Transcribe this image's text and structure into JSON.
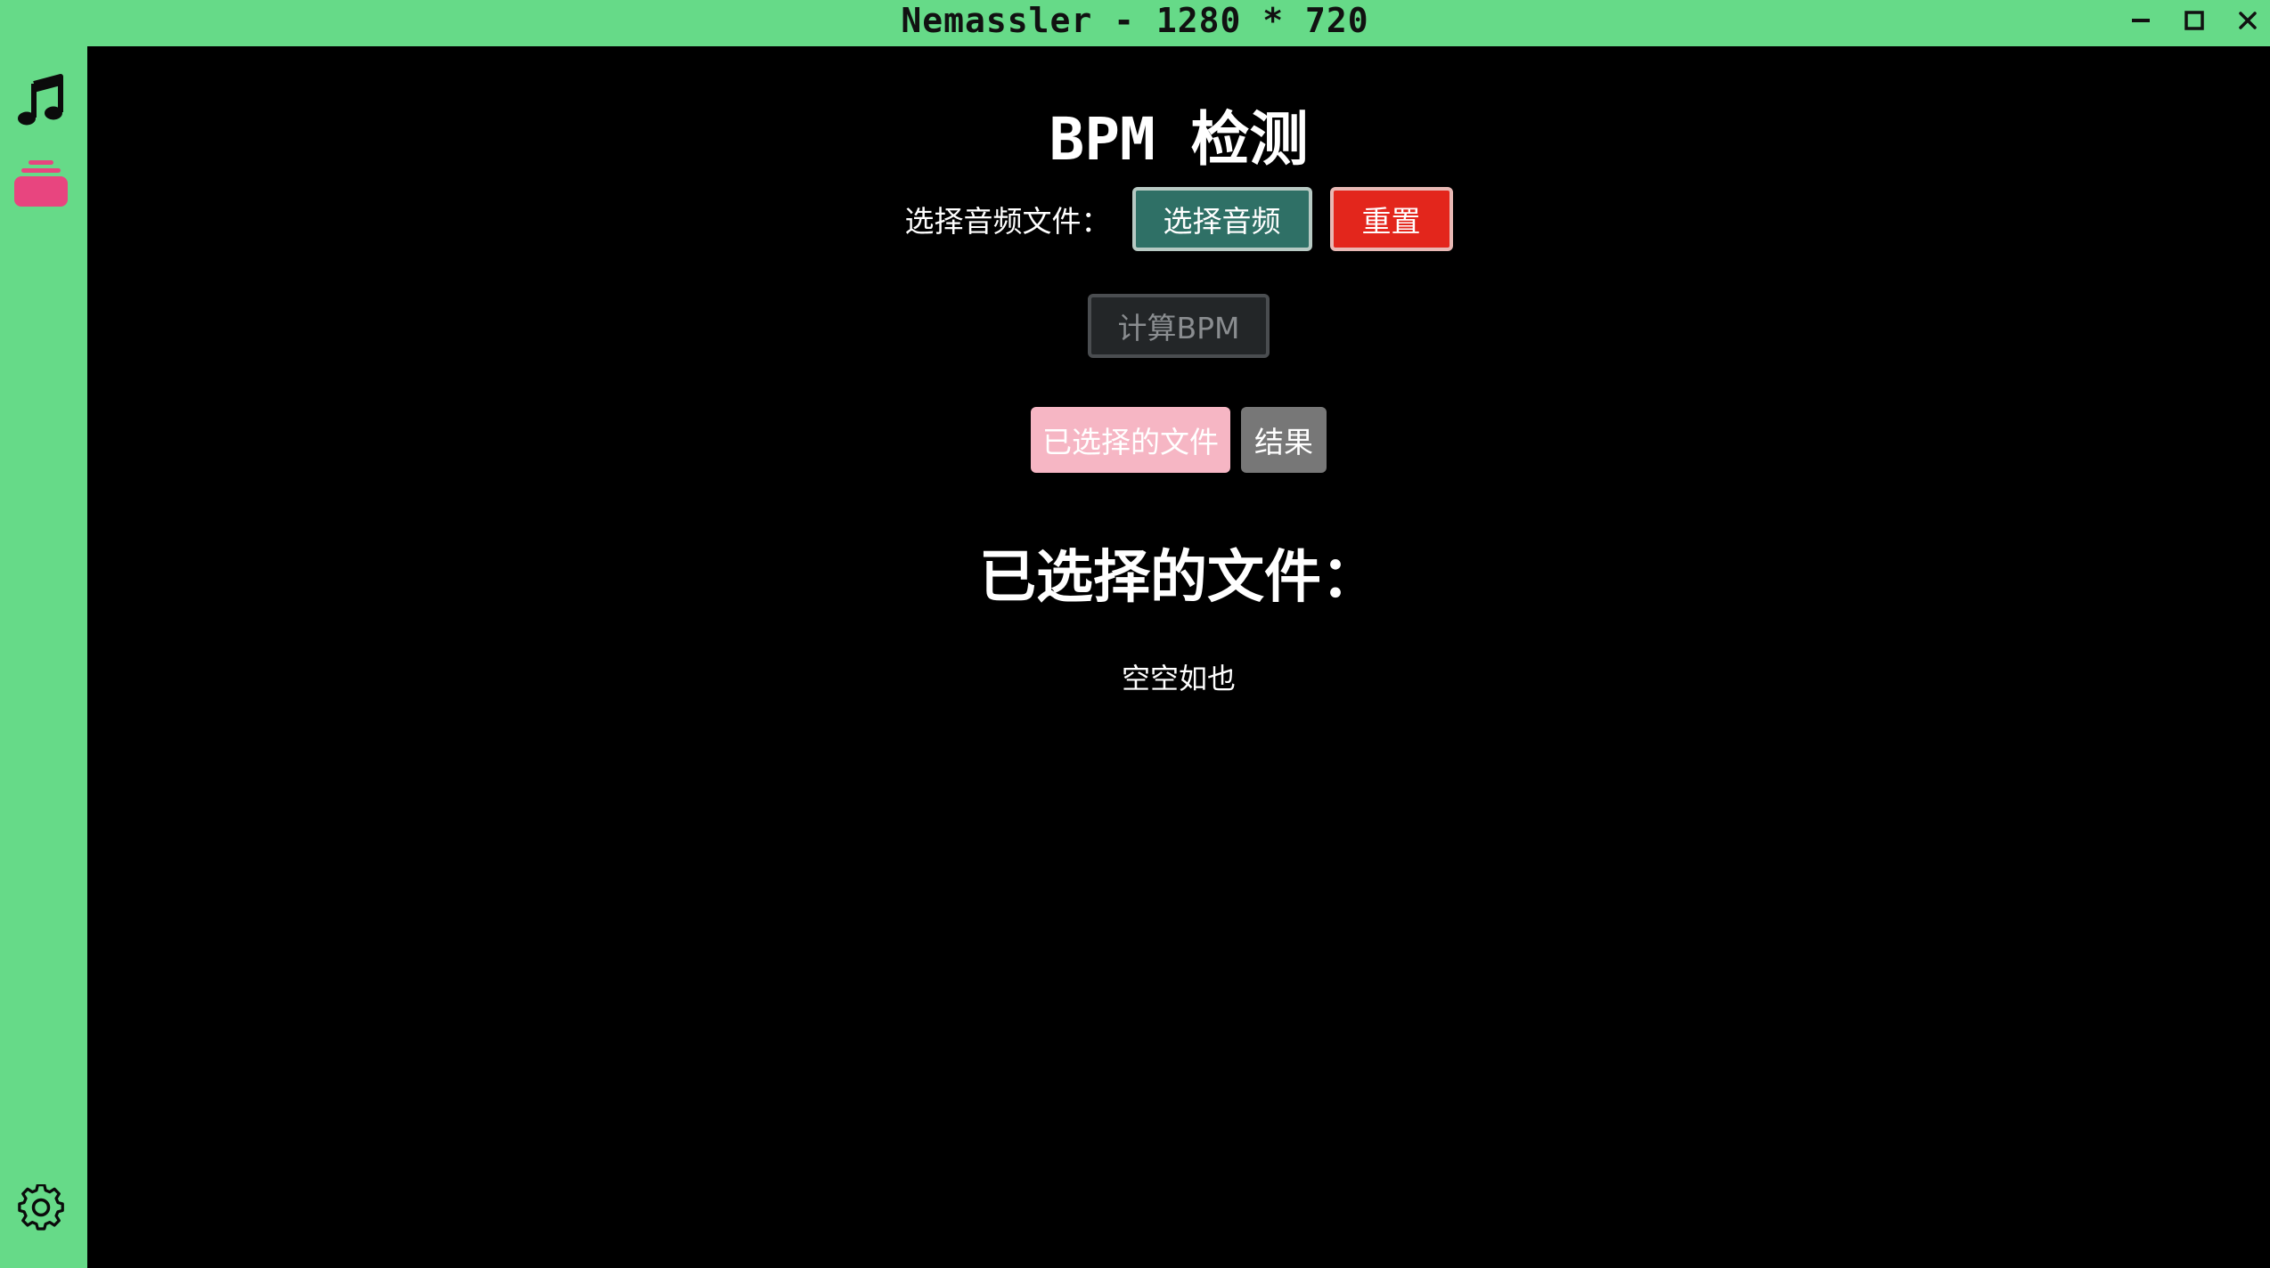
{
  "window": {
    "title": "Nemassler - 1280 * 720",
    "controls": {
      "minimize_icon": "minimize-icon",
      "maximize_icon": "maximize-icon",
      "close_icon": "close-icon"
    }
  },
  "sidebar": {
    "items": [
      {
        "icon": "music-note-icon"
      },
      {
        "icon": "stack-icon",
        "color": "#e8457f"
      }
    ],
    "footer": {
      "icon": "gear-icon"
    }
  },
  "main": {
    "title": "BPM 检测",
    "select_label": "选择音频文件：",
    "choose_button": "选择音频",
    "reset_button": "重置",
    "calculate_button": "计算BPM",
    "tabs": [
      {
        "label": "已选择的文件",
        "active": true
      },
      {
        "label": "结果",
        "active": false
      }
    ],
    "section_title": "已选择的文件：",
    "empty_text": "空空如也"
  },
  "colors": {
    "accent_green": "#66da88",
    "choose_button": "#2f7066",
    "reset_button": "#e3261c",
    "tab_active": "#f6b6c4",
    "tab_inactive": "#777777"
  }
}
